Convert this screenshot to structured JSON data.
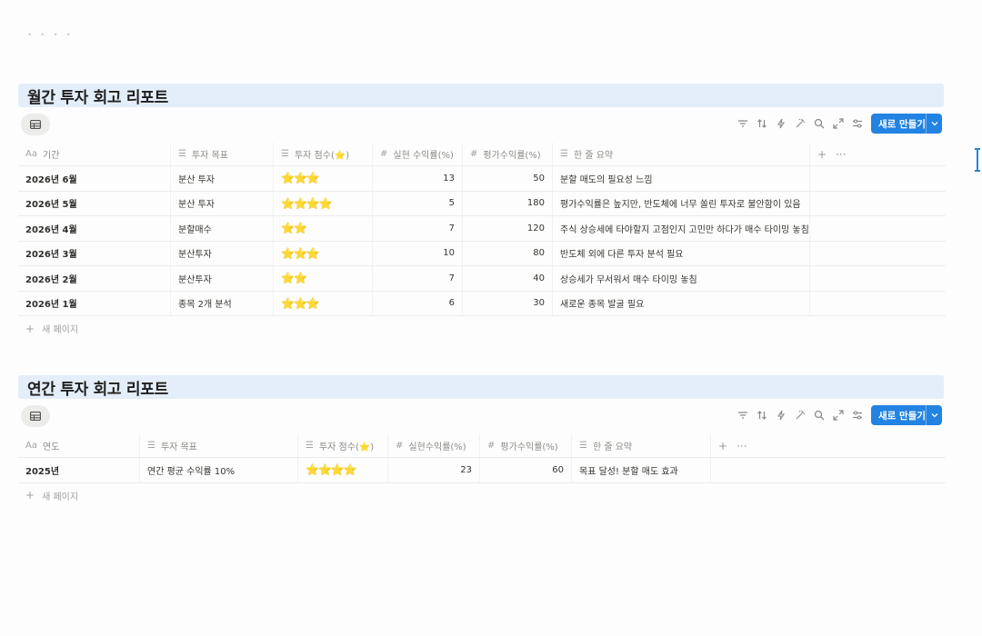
{
  "new_button_label": "새로 만들기",
  "add_row_label": "새 페이지",
  "monthly": {
    "title": "월간 투자 회고 리포트",
    "columns": {
      "period": "기간",
      "goal": "투자 목표",
      "score": "투자 점수(⭐)",
      "realized": "실현 수익률(%)",
      "unrealized": "평가수익률(%)",
      "summary": "한 줄 요약"
    },
    "rows": [
      {
        "period": "2026년 6월",
        "goal": "분산 투자",
        "score": "⭐⭐⭐",
        "realized": "13",
        "unrealized": "50",
        "summary": "분할 매도의 필요성 느낌"
      },
      {
        "period": "2026년 5월",
        "goal": "분산 투자",
        "score": "⭐⭐⭐⭐",
        "realized": "5",
        "unrealized": "180",
        "summary": "평가수익률은 높지만, 반도체에 너무 쏠린 투자로 불안함이 있음"
      },
      {
        "period": "2026년 4월",
        "goal": "분할매수",
        "score": "⭐⭐",
        "realized": "7",
        "unrealized": "120",
        "summary": "주식 상승세에 타야할지 고점인지 고민만 하다가 매수 타이밍 놓침"
      },
      {
        "period": "2026년 3월",
        "goal": "분산투자",
        "score": "⭐⭐⭐",
        "realized": "10",
        "unrealized": "80",
        "summary": "반도체 외에 다른 투자 분석 필요"
      },
      {
        "period": "2026년 2월",
        "goal": "분산투자",
        "score": "⭐⭐",
        "realized": "7",
        "unrealized": "40",
        "summary": "상승세가 무서워서 매수 타이밍 놓침"
      },
      {
        "period": "2026년 1월",
        "goal": "종목 2개 분석",
        "score": "⭐⭐⭐",
        "realized": "6",
        "unrealized": "30",
        "summary": "새로운 종목 발굴 필요"
      }
    ]
  },
  "annual": {
    "title": "연간 투자 회고 리포트",
    "columns": {
      "year": "연도",
      "goal": "투자 목표",
      "score": "투자 점수(⭐)",
      "realized": "실현수익률(%)",
      "unrealized": "평가수익률(%)",
      "summary": "한 줄 요약"
    },
    "rows": [
      {
        "year": "2025년",
        "goal": "연간 평균 수익률 10%",
        "score": "⭐⭐⭐⭐",
        "realized": "23",
        "unrealized": "60",
        "summary": "목표 달성! 분할 매도 효과"
      }
    ]
  },
  "colors": {
    "accent": "#2383e2",
    "title_bg": "#e4eefa",
    "star": "#f5c13d"
  }
}
